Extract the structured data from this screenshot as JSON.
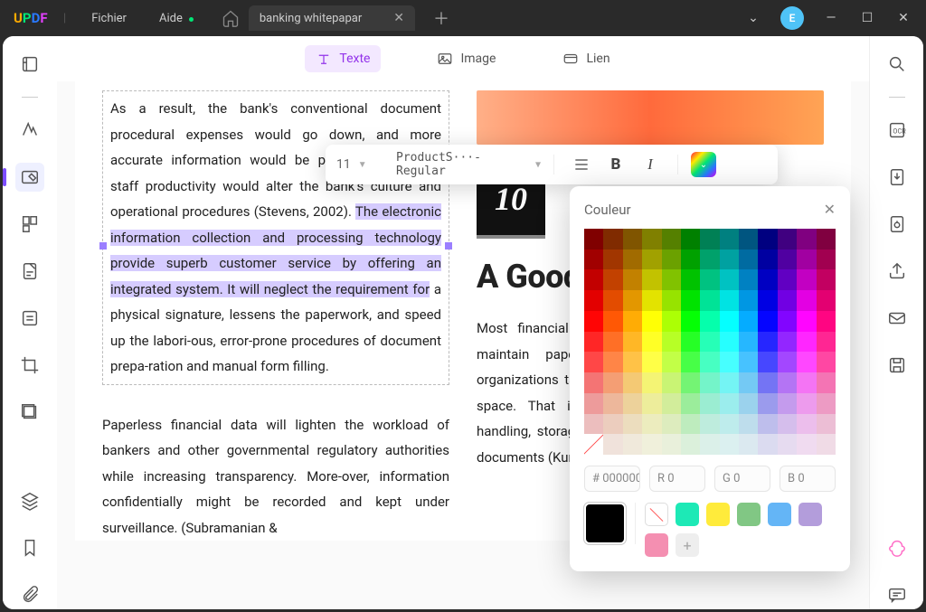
{
  "app": {
    "logo": "UPDF",
    "menu_file": "Fichier",
    "menu_help": "Aide"
  },
  "tab": {
    "title": "banking whitepapar"
  },
  "avatar": {
    "letter": "E"
  },
  "edit_tabs": {
    "text": "Texte",
    "image": "Image",
    "link": "Lien"
  },
  "doc": {
    "p1_a": "As a result, the bank's conventional document procedural expenses would go down, and more accurate   information   would   be   provided. Increased staff productivity would alter the bank's culture and operational procedures (Stevens, 2002). ",
    "p1_hl": "The electronic information collection and processing technology provide superb customer service by offering an integrated system. It will neglect the requirement for",
    "p1_b": " a physical signature, lessens the paperwork, and speed up the labori-ous, error-prone procedures of document prepa-ration and manual form filling.",
    "p2": "Paperless financial data will lighten the workload of bankers and other governmental regulatory authorities while increasing transparency. More-over, information confidentially might be recorded and kept under surveillance. (Subramanian &",
    "chapter_num": "10",
    "chapter_title": "A Good Development",
    "right_text": "Most financial institutions spend a lot of costs to maintain paper records. Numer-ous records for organizations take time-consuming to find and physical space. That is because of paper-based document handling, storage costs and unnecessary duplication of documents (Kumari 2021)."
  },
  "fmt": {
    "size": "11",
    "font": "ProductS···-Regular"
  },
  "color": {
    "title": "Couleur",
    "hex_label": "#",
    "hex": "000000",
    "r_label": "R",
    "r": "0",
    "g_label": "G",
    "g": "0",
    "b_label": "B",
    "b": "0",
    "presets": [
      "#ffffff",
      "#1de9b6",
      "#ffeb3b",
      "#81c784",
      "#64b5f6",
      "#b39ddb",
      "#f48fb1"
    ]
  }
}
